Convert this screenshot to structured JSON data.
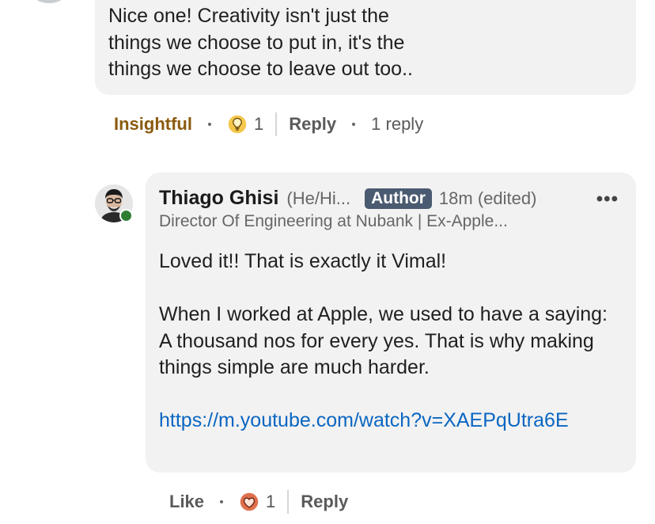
{
  "top_comment": {
    "text_lines": [
      "Nice one! Creativity isn't just the",
      "things we choose to put in, it's the",
      "things we choose to leave out too.."
    ],
    "reaction_label": "Insightful",
    "reaction_icon": "lightbulb-icon",
    "reaction_count": "1",
    "reply_label": "Reply",
    "replies_count_label": "1 reply"
  },
  "reply_comment": {
    "author_name": "Thiago Ghisi",
    "pronouns": "(He/Hi...",
    "author_badge": "Author",
    "timestamp": "18m (edited)",
    "menu_icon": "more-icon",
    "headline": "Director Of Engineering at Nubank | Ex-Apple...",
    "paragraphs": [
      "Loved it!! That is exactly it Vimal!",
      "When I worked at Apple, we used to have a saying: A thousand nos for every yes. That is why making things simple are much harder."
    ],
    "link_text": "https://m.youtube.com/watch?v=XAEPqUtra6E",
    "like_label": "Like",
    "reaction_icon": "heart-icon",
    "reaction_count": "1",
    "reply_label": "Reply"
  },
  "colors": {
    "bubble_bg": "#f2f2f2",
    "insightful": "#8a5a0e",
    "link": "#0a66c2",
    "author_badge_bg": "#4a5a70",
    "presence": "#2e7d32"
  }
}
